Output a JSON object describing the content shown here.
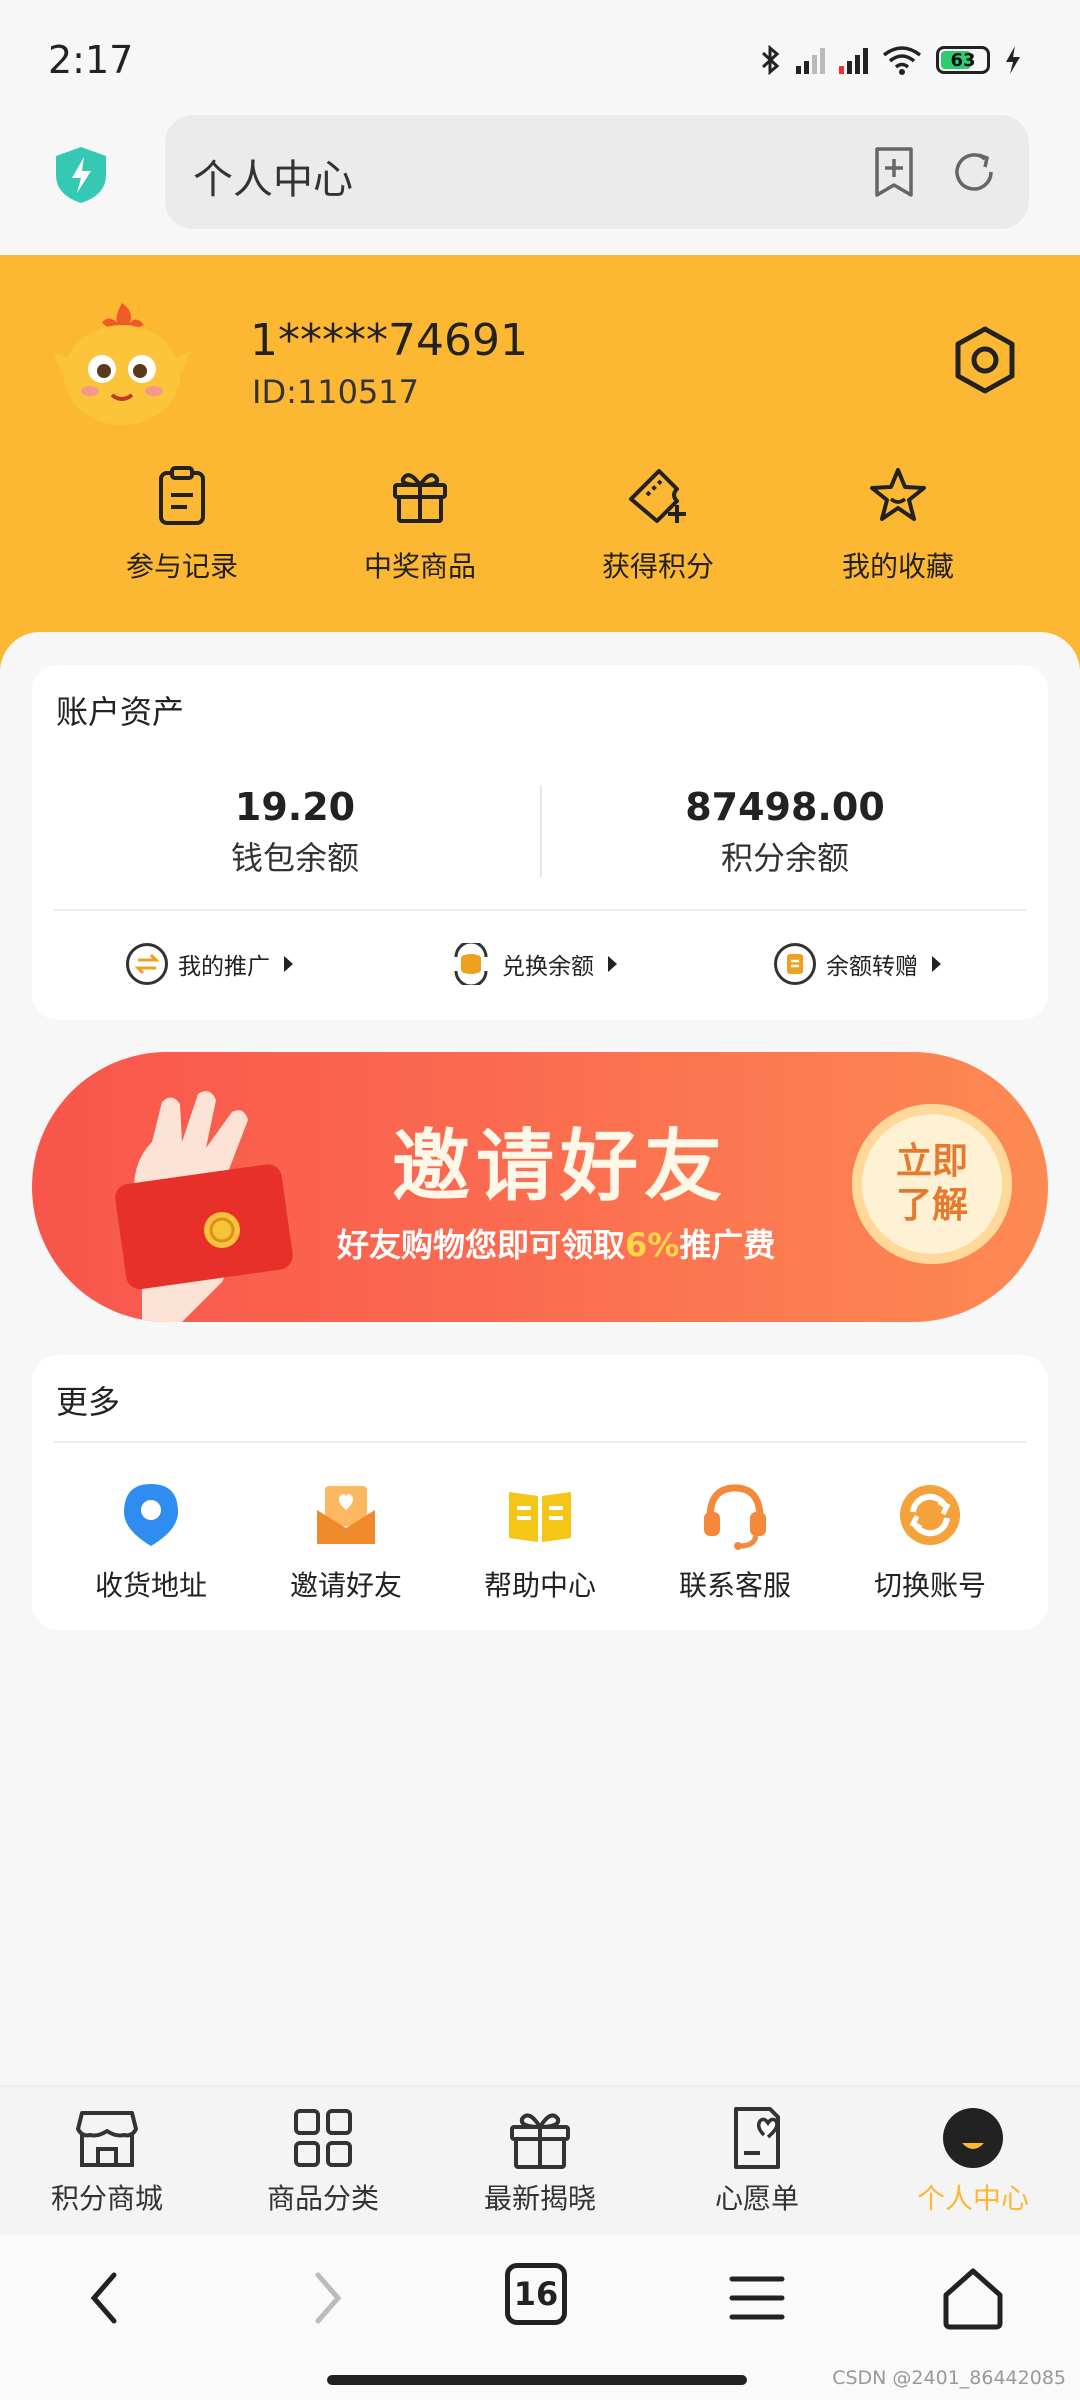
{
  "status": {
    "time": "2:17",
    "battery": "63"
  },
  "browser": {
    "url_text": "个人中心"
  },
  "profile": {
    "phone": "1*****74691",
    "user_id": "ID:110517"
  },
  "quick_actions": [
    {
      "label": "参与记录",
      "icon": "clipboard-icon"
    },
    {
      "label": "中奖商品",
      "icon": "gift-icon"
    },
    {
      "label": "获得积分",
      "icon": "ticket-plus-icon"
    },
    {
      "label": "我的收藏",
      "icon": "star-icon"
    }
  ],
  "assets": {
    "title": "账户资产",
    "wallet_value": "19.20",
    "wallet_label": "钱包余额",
    "points_value": "87498.00",
    "points_label": "积分余额",
    "links": [
      {
        "label": "我的推广",
        "icon": "exchange-icon"
      },
      {
        "label": "兑换余额",
        "icon": "coin-stack-icon"
      },
      {
        "label": "余额转赠",
        "icon": "gift-transfer-icon"
      }
    ]
  },
  "banner": {
    "title": "邀请好友",
    "subtitle_pre": "好友购物您即可领取",
    "subtitle_highlight": "6%",
    "subtitle_post": "推广费",
    "button_line1": "立即",
    "button_line2": "了解"
  },
  "more": {
    "title": "更多",
    "items": [
      {
        "label": "收货地址",
        "icon": "location-pin-icon",
        "color": "#2f8cf0"
      },
      {
        "label": "邀请好友",
        "icon": "invite-envelope-icon",
        "color": "#f39c3c"
      },
      {
        "label": "帮助中心",
        "icon": "book-icon",
        "color": "#f5c518"
      },
      {
        "label": "联系客服",
        "icon": "headset-icon",
        "color": "#f5883a"
      },
      {
        "label": "切换账号",
        "icon": "switch-icon",
        "color": "#f5a23a"
      }
    ]
  },
  "tabs": [
    {
      "label": "积分商城",
      "icon": "store-icon"
    },
    {
      "label": "商品分类",
      "icon": "grid-icon"
    },
    {
      "label": "最新揭晓",
      "icon": "gift-box-icon"
    },
    {
      "label": "心愿单",
      "icon": "wishlist-icon"
    },
    {
      "label": "个人中心",
      "icon": "profile-face-icon",
      "active": true
    }
  ],
  "sysnav": {
    "tab_count": "16"
  },
  "watermark": "CSDN @2401_86442085",
  "colors": {
    "accent": "#fdb833",
    "background": "#f7f7f7"
  }
}
